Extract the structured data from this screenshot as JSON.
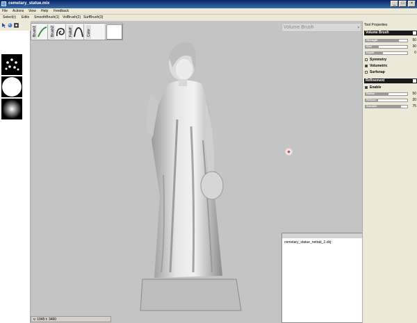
{
  "window": {
    "title": "cemetary_statue.mix",
    "controls": [
      "_",
      "□",
      "×"
    ]
  },
  "menu": [
    "File",
    "Actions",
    "View",
    "Help",
    "Feedback"
  ],
  "tabs": [
    "Select(r)",
    "Edits",
    "SmoothBrush(1)",
    "VolBrush(2)",
    "SurfBrush(3)"
  ],
  "left_toolbar": {
    "icons": [
      "select-cursor-icon",
      "sphere-icon",
      "square-icon"
    ]
  },
  "left_panel": {
    "thumbnails": [
      "dots-brush-thumbnail",
      "sphere-brush-thumbnail",
      "gradient-falloff-thumbnail"
    ]
  },
  "brush_strip": {
    "items": [
      {
        "label": "Brush1",
        "icon": "line-curve-icon"
      },
      {
        "label": "Brush2",
        "icon": "spiral-curve-icon"
      },
      {
        "label": "Falloff",
        "icon": "falloff-curve-icon"
      },
      {
        "label": "Color",
        "icon": "color-swatch"
      }
    ]
  },
  "brush_selector": {
    "label": "Volume Brush",
    "arrow": "▾"
  },
  "tool_properties": {
    "header": "Tool Properties",
    "volume_brush": {
      "title": "Volume Brush",
      "sliders": [
        {
          "name": "Strength",
          "value": "50",
          "fill": 0.8
        },
        {
          "name": "Size",
          "value": "30",
          "fill": 0.32
        },
        {
          "name": "Depth",
          "value": "0",
          "fill": 0.42
        }
      ],
      "checkboxes": [
        {
          "label": "Symmetry",
          "checked": false
        },
        {
          "label": "Volumetric",
          "checked": true
        },
        {
          "label": "Surfsnap",
          "checked": false
        }
      ]
    },
    "refinement": {
      "title": "Refinement",
      "checkboxes": [
        {
          "label": "Enable",
          "checked": true
        }
      ],
      "sliders": [
        {
          "name": "Refine",
          "value": "50",
          "fill": 0.55
        },
        {
          "name": "Reduce",
          "value": "20",
          "fill": 0.3
        },
        {
          "name": "Smooth",
          "value": "75",
          "fill": 0.85
        }
      ]
    }
  },
  "doc_panel": {
    "tab": "cemetary_statue_nettab_2.obj"
  },
  "status": {
    "text": "v: 1945 t: 3460"
  }
}
